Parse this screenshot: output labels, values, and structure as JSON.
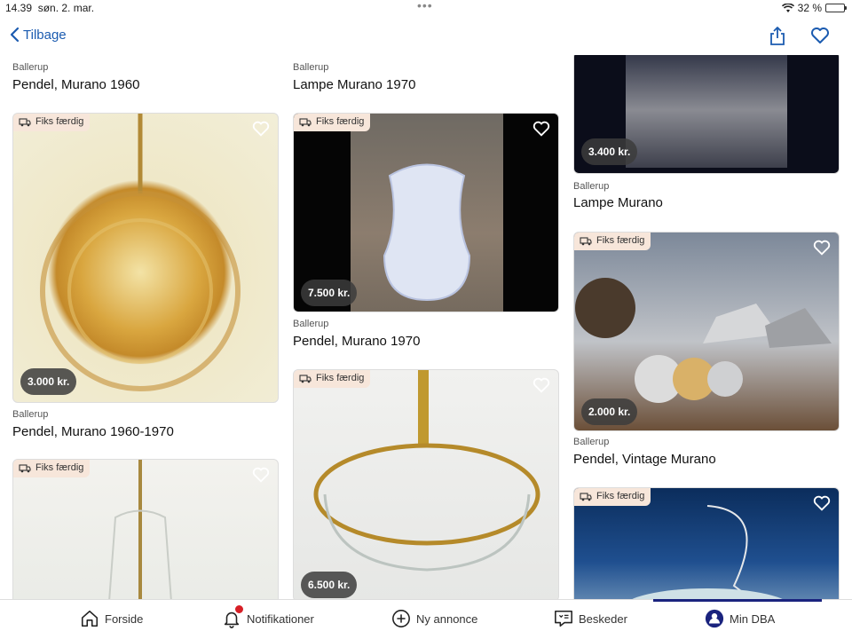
{
  "status": {
    "time": "14.39",
    "date": "søn. 2. mar.",
    "battery": "32 %",
    "battery_level": 0.32
  },
  "nav": {
    "back_label": "Tilbage"
  },
  "cards": [
    {
      "location": "Ballerup",
      "title": "Pendel, Murano 1960"
    },
    {
      "location": "Ballerup",
      "title": "Lampe Murano 1970"
    },
    {
      "price": "3.400 kr.",
      "location": "Ballerup",
      "title": "Lampe Murano"
    },
    {
      "badge": "Fiks færdig",
      "price": "3.000 kr.",
      "location": "Ballerup",
      "title": "Pendel, Murano 1960-1970"
    },
    {
      "badge": "Fiks færdig",
      "price": "7.500 kr.",
      "location": "Ballerup",
      "title": "Pendel, Murano 1970"
    },
    {
      "badge": "Fiks færdig",
      "price": "2.000 kr.",
      "location": "Ballerup",
      "title": "Pendel, Vintage Murano"
    },
    {
      "badge": "Fiks færdig"
    },
    {
      "badge": "Fiks færdig",
      "price": "6.500 kr."
    },
    {
      "badge": "Fiks færdig"
    }
  ],
  "tabs": {
    "home": "Forside",
    "notifications": "Notifikationer",
    "new_ad": "Ny annonce",
    "messages": "Beskeder",
    "my_dba": "Min DBA"
  },
  "colors": {
    "accent": "#1b5bb0",
    "badge_bg": "#f7e6da",
    "active_tab": "#1a237e",
    "notification": "#d71f26"
  }
}
